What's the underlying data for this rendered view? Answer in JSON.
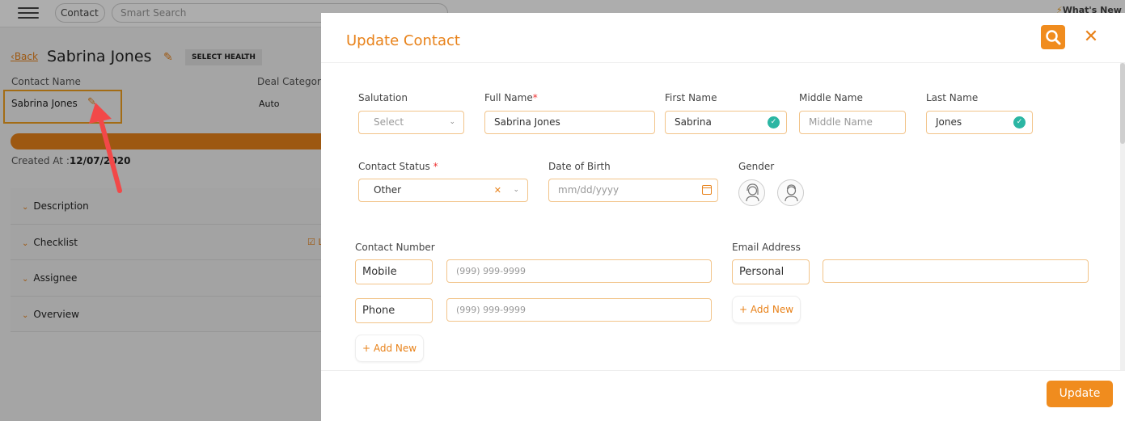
{
  "topbar": {
    "module": "Contact",
    "search_placeholder": "Smart Search",
    "whats_new": "What's New"
  },
  "record": {
    "back": "Back",
    "title": "Sabrina Jones",
    "select_health": "SELECT HEALTH",
    "contact_name_label": "Contact Name",
    "contact_name_value": "Sabrina Jones",
    "deal_category_label": "Deal Categor",
    "deal_category_value": "Auto",
    "created_at_label": "Created At :",
    "created_at_value": "12/07/2020",
    "sections": [
      "Description",
      "Checklist",
      "Assignee",
      "Overview"
    ],
    "checklist_mark": "L",
    "progress_color": "#e8821a"
  },
  "modal": {
    "title": "Update Contact",
    "salutation": {
      "label": "Salutation",
      "value": "Select"
    },
    "full_name": {
      "label": "Full Name",
      "required": "*",
      "value": "Sabrina Jones"
    },
    "first_name": {
      "label": "First Name",
      "value": "Sabrina"
    },
    "middle_name": {
      "label": "Middle Name",
      "placeholder": "Middle Name"
    },
    "last_name": {
      "label": "Last Name",
      "value": "Jones"
    },
    "contact_status": {
      "label": "Contact Status",
      "required": "*",
      "value": "Other"
    },
    "dob": {
      "label": "Date of Birth",
      "placeholder": "mm/dd/yyyy"
    },
    "gender": {
      "label": "Gender"
    },
    "contact_number": {
      "label": "Contact Number",
      "rows": [
        {
          "type": "Mobile",
          "placeholder": "(999) 999-9999"
        },
        {
          "type": "Phone",
          "placeholder": "(999) 999-9999"
        }
      ],
      "add_new": "+ Add New"
    },
    "email": {
      "label": "Email Address",
      "type": "Personal",
      "value": "",
      "add_new": "+ Add New"
    },
    "update_button": "Update",
    "accent_color": "#e8821a"
  }
}
